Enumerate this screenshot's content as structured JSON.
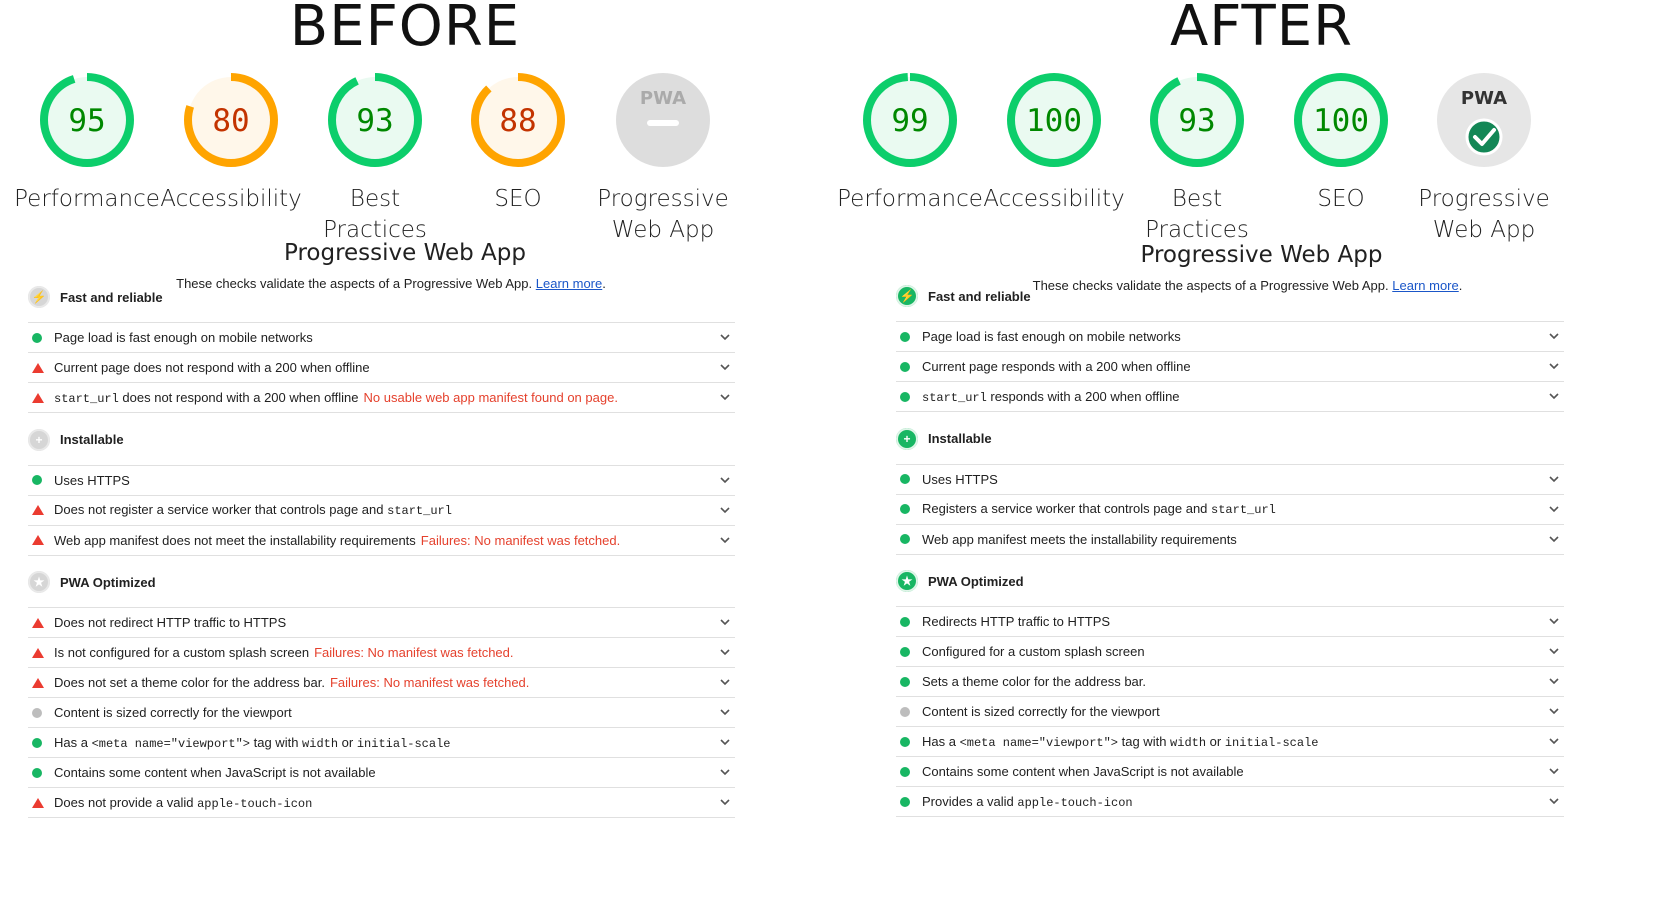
{
  "before": {
    "heading": "BEFORE",
    "gauges": [
      {
        "score": 95,
        "label_lines": [
          "Performance"
        ],
        "rating": "pass"
      },
      {
        "score": 80,
        "label_lines": [
          "Accessibility"
        ],
        "rating": "average"
      },
      {
        "score": 93,
        "label_lines": [
          "Best",
          "Practices"
        ],
        "rating": "pass"
      },
      {
        "score": 88,
        "label_lines": [
          "SEO"
        ],
        "rating": "average"
      },
      {
        "badge": "PWA",
        "label_lines": [
          "Progressive",
          "Web App"
        ],
        "rating": "pwa-fail"
      }
    ],
    "section_title": "Progressive Web App",
    "section_desc": "These checks validate the aspects of a Progressive Web App.",
    "learn_more": "Learn more",
    "groups": [
      {
        "title": "Fast and reliable",
        "icon": "lightning-icon",
        "status": "gray",
        "audits": [
          {
            "status": "pass",
            "parts": [
              {
                "t": "Page load is fast enough on mobile networks"
              }
            ]
          },
          {
            "status": "fail",
            "parts": [
              {
                "t": "Current page does not respond with a 200 when offline"
              }
            ]
          },
          {
            "status": "fail",
            "parts": [
              {
                "t": "start_url",
                "code": true
              },
              {
                "t": " does not respond with a 200 when offline"
              },
              {
                "t": "No usable web app manifest found on page.",
                "fail": true
              }
            ]
          }
        ]
      },
      {
        "title": "Installable",
        "icon": "plus-icon",
        "status": "gray",
        "audits": [
          {
            "status": "pass",
            "parts": [
              {
                "t": "Uses HTTPS"
              }
            ]
          },
          {
            "status": "fail",
            "parts": [
              {
                "t": "Does not register a service worker that controls page and "
              },
              {
                "t": "start_url",
                "code": true
              }
            ]
          },
          {
            "status": "fail",
            "parts": [
              {
                "t": "Web app manifest does not meet the installability requirements"
              },
              {
                "t": "Failures: No manifest was fetched.",
                "fail": true
              }
            ]
          }
        ]
      },
      {
        "title": "PWA Optimized",
        "icon": "star-icon",
        "status": "gray",
        "audits": [
          {
            "status": "fail",
            "parts": [
              {
                "t": "Does not redirect HTTP traffic to HTTPS"
              }
            ]
          },
          {
            "status": "fail",
            "parts": [
              {
                "t": "Is not configured for a custom splash screen"
              },
              {
                "t": "Failures: No manifest was fetched.",
                "fail": true
              }
            ]
          },
          {
            "status": "fail",
            "parts": [
              {
                "t": "Does not set a theme color for the address bar."
              },
              {
                "t": "Failures: No manifest was fetched.",
                "fail": true
              }
            ]
          },
          {
            "status": "info",
            "parts": [
              {
                "t": "Content is sized correctly for the viewport"
              }
            ]
          },
          {
            "status": "pass",
            "parts": [
              {
                "t": "Has a "
              },
              {
                "t": "<meta name=\"viewport\">",
                "code": true
              },
              {
                "t": " tag with "
              },
              {
                "t": "width",
                "code": true
              },
              {
                "t": " or "
              },
              {
                "t": "initial-scale",
                "code": true
              }
            ]
          },
          {
            "status": "pass",
            "parts": [
              {
                "t": "Contains some content when JavaScript is not available"
              }
            ]
          },
          {
            "status": "fail",
            "parts": [
              {
                "t": "Does not provide a valid "
              },
              {
                "t": "apple-touch-icon",
                "code": true
              }
            ]
          }
        ]
      }
    ]
  },
  "after": {
    "heading": "AFTER",
    "gauges": [
      {
        "score": 99,
        "label_lines": [
          "Performance"
        ],
        "rating": "pass"
      },
      {
        "score": 100,
        "label_lines": [
          "Accessibility"
        ],
        "rating": "pass"
      },
      {
        "score": 93,
        "label_lines": [
          "Best",
          "Practices"
        ],
        "rating": "pass"
      },
      {
        "score": 100,
        "label_lines": [
          "SEO"
        ],
        "rating": "pass"
      },
      {
        "badge": "PWA",
        "label_lines": [
          "Progressive",
          "Web App"
        ],
        "rating": "pwa-pass"
      }
    ],
    "section_title": "Progressive Web App",
    "section_desc": "These checks validate the aspects of a Progressive Web App.",
    "learn_more": "Learn more",
    "groups": [
      {
        "title": "Fast and reliable",
        "icon": "lightning-icon",
        "status": "green",
        "audits": [
          {
            "status": "pass",
            "parts": [
              {
                "t": "Page load is fast enough on mobile networks"
              }
            ]
          },
          {
            "status": "pass",
            "parts": [
              {
                "t": "Current page responds with a 200 when offline"
              }
            ]
          },
          {
            "status": "pass",
            "parts": [
              {
                "t": "start_url",
                "code": true
              },
              {
                "t": " responds with a 200 when offline"
              }
            ]
          }
        ]
      },
      {
        "title": "Installable",
        "icon": "plus-icon",
        "status": "green",
        "audits": [
          {
            "status": "pass",
            "parts": [
              {
                "t": "Uses HTTPS"
              }
            ]
          },
          {
            "status": "pass",
            "parts": [
              {
                "t": "Registers a service worker that controls page and "
              },
              {
                "t": "start_url",
                "code": true
              }
            ]
          },
          {
            "status": "pass",
            "parts": [
              {
                "t": "Web app manifest meets the installability requirements"
              }
            ]
          }
        ]
      },
      {
        "title": "PWA Optimized",
        "icon": "star-icon",
        "status": "green",
        "audits": [
          {
            "status": "pass",
            "parts": [
              {
                "t": "Redirects HTTP traffic to HTTPS"
              }
            ]
          },
          {
            "status": "pass",
            "parts": [
              {
                "t": "Configured for a custom splash screen"
              }
            ]
          },
          {
            "status": "pass",
            "parts": [
              {
                "t": "Sets a theme color for the address bar."
              }
            ]
          },
          {
            "status": "info",
            "parts": [
              {
                "t": "Content is sized correctly for the viewport"
              }
            ]
          },
          {
            "status": "pass",
            "parts": [
              {
                "t": "Has a "
              },
              {
                "t": "<meta name=\"viewport\">",
                "code": true
              },
              {
                "t": " tag with "
              },
              {
                "t": "width",
                "code": true
              },
              {
                "t": " or "
              },
              {
                "t": "initial-scale",
                "code": true
              }
            ]
          },
          {
            "status": "pass",
            "parts": [
              {
                "t": "Contains some content when JavaScript is not available"
              }
            ]
          },
          {
            "status": "pass",
            "parts": [
              {
                "t": "Provides a valid "
              },
              {
                "t": "apple-touch-icon",
                "code": true
              }
            ]
          }
        ]
      }
    ]
  },
  "colors": {
    "pass": "#0cce6b",
    "pass_text": "#008800",
    "pass_fill": "#eafaf1",
    "average": "#ffa400",
    "average_text": "#c33300",
    "average_fill": "#fff7ea",
    "fail": "#eb3b30",
    "gray": "#e0e0e0"
  }
}
